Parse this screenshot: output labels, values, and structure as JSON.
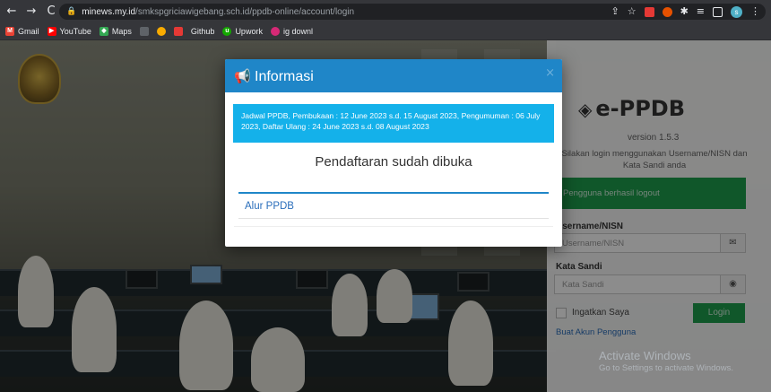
{
  "browser": {
    "url_host": "minews.my.id",
    "url_path": "/smkspgriciawigebang.sch.id/ppdb-online/account/login",
    "bookmarks": [
      "Gmail",
      "YouTube",
      "Maps",
      "Github",
      "Upwork",
      "ig downl"
    ],
    "profile_initial": "s"
  },
  "login": {
    "brand": "e-PPDB",
    "version": "version 1.5.3",
    "instruction": "Silakan login menggunakan Username/NISN dan Kata Sandi anda",
    "logout_alert": "Pengguna berhasil logout",
    "username_label": "Username/NISN",
    "username_placeholder": "Username/NISN",
    "password_label": "Kata Sandi",
    "password_placeholder": "Kata Sandi",
    "remember_label": "Ingatkan Saya",
    "login_button": "Login",
    "register_link": "Buat Akun Pengguna"
  },
  "modal": {
    "title": "Informasi",
    "info_text": "Jadwal PPDB, Pembukaan : 12 June 2023 s.d. 15 August 2023, Pengumuman : 06 July 2023, Daftar Ulang : 24 June 2023 s.d. 08 August 2023",
    "subtitle": "Pendaftaran sudah dibuka",
    "panel_link": "Alur PPDB"
  },
  "windows_watermark": {
    "title": "Activate Windows",
    "subtitle": "Go to Settings to activate Windows."
  },
  "colors": {
    "modal_header": "#1f86c8",
    "info_alert": "#14b1ea",
    "success": "#1e9e4d",
    "link": "#2a6ebb"
  }
}
